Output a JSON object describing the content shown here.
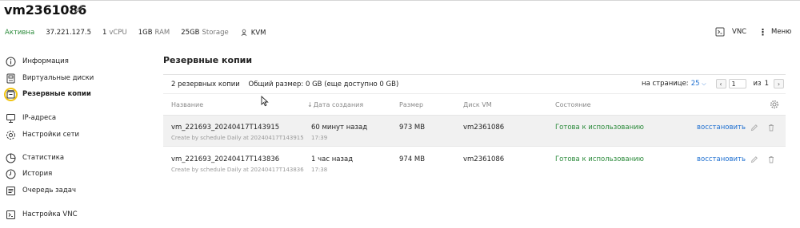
{
  "vm": {
    "name": "vm2361086",
    "status": "Активна",
    "ip": "37.221.127.5",
    "vcpu_count": "1",
    "vcpu_unit": "vCPU",
    "ram_value": "1GB",
    "ram_unit": "RAM",
    "storage_value": "25GB",
    "storage_unit": "Storage",
    "virtualization": "KVM"
  },
  "header": {
    "vnc_label": "VNC",
    "menu_label": "Меню"
  },
  "sidebar": {
    "items": [
      {
        "label": "Информация",
        "icon": "info-icon"
      },
      {
        "label": "Виртуальные диски",
        "icon": "disk-icon"
      },
      {
        "label": "Резервные копии",
        "icon": "backup-icon",
        "active": true
      },
      {
        "label": "IP-адреса",
        "icon": "ip-icon"
      },
      {
        "label": "Настройки сети",
        "icon": "network-icon"
      },
      {
        "label": "Статистика",
        "icon": "chart-icon"
      },
      {
        "label": "История",
        "icon": "history-icon"
      },
      {
        "label": "Очередь задач",
        "icon": "task-queue-icon"
      },
      {
        "label": "Настройка VNC",
        "icon": "vnc-settings-icon"
      }
    ]
  },
  "backups": {
    "title": "Резервные копии",
    "count_text": "2 резервных копии",
    "total_size_text": "Общий размер: 0 GB (еще доступно 0 GB)",
    "per_page_label": "на странице:",
    "per_page_value": "25",
    "page_current": "1",
    "page_of_label": "из",
    "page_total": "1",
    "columns": {
      "name": "Название",
      "created": "Дата создания",
      "size": "Размер",
      "disk": "Диск VM",
      "state": "Состояние"
    },
    "rows": [
      {
        "name": "vm_221693_20240417T143915",
        "description": "Create by schedule Daily at 20240417T143915",
        "created": "60 минут назад",
        "created_time": "17:39",
        "size": "973 MB",
        "disk": "vm2361086",
        "state": "Готова к использованию",
        "restore_label": "восстановить"
      },
      {
        "name": "vm_221693_20240417T143836",
        "description": "Create by schedule Daily at 20240417T143836",
        "created": "1 час назад",
        "created_time": "17:38",
        "size": "974 MB",
        "disk": "vm2361086",
        "state": "Готова к использованию",
        "restore_label": "восстановить"
      }
    ]
  },
  "colors": {
    "status_green": "#2a8a3a",
    "link_blue": "#1e6fd0",
    "active_ring": "#f1c40f"
  }
}
